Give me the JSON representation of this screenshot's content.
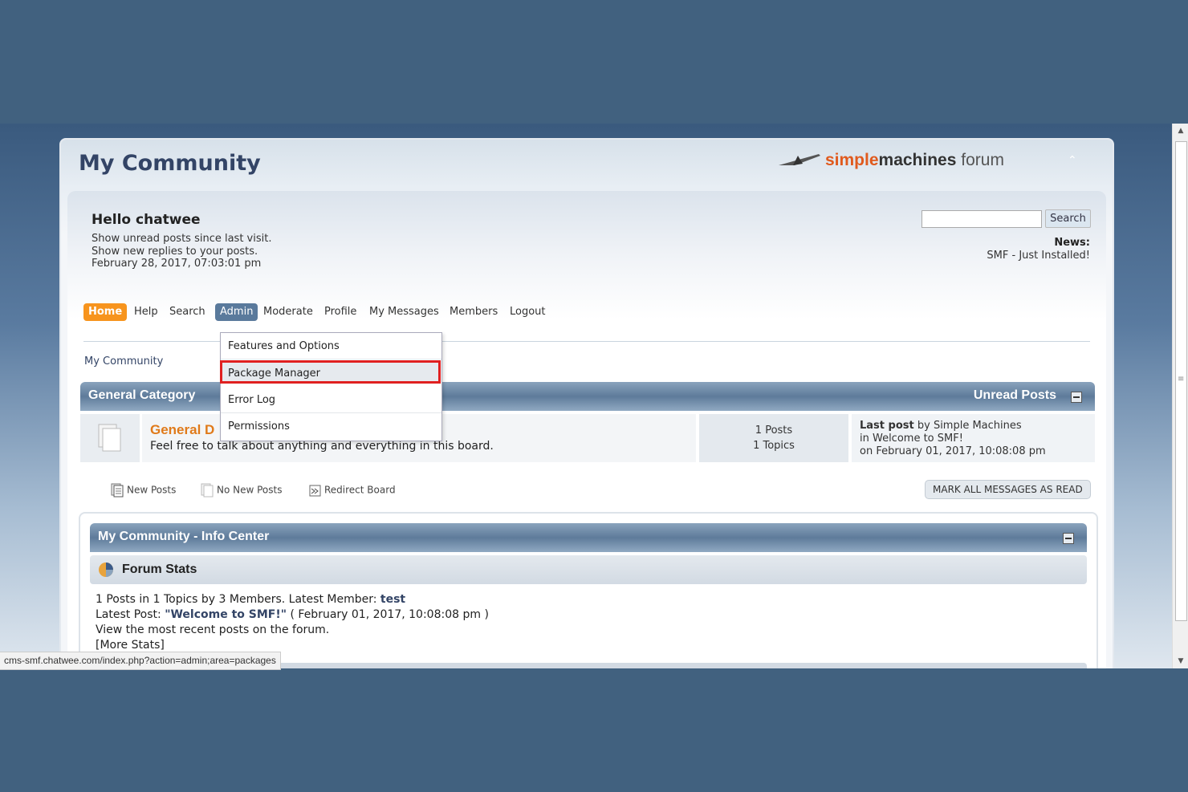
{
  "site": {
    "title": "My Community",
    "logo_a": "simple",
    "logo_b": "machines",
    "logo_c": " forum",
    "collapse_icon": "chevron-up-icon"
  },
  "user": {
    "hello": "Hello chatwee",
    "links": [
      "Show unread posts since last visit.",
      "Show new replies to your posts."
    ],
    "date": "February 28, 2017, 07:03:01 pm"
  },
  "search": {
    "value": "",
    "button": "Search"
  },
  "news": {
    "label": "News:",
    "text": "SMF - Just Installed!"
  },
  "menu": [
    "Home",
    "Help",
    "Search",
    "Admin",
    "Moderate",
    "Profile",
    "My Messages",
    "Members",
    "Logout"
  ],
  "dropdown": [
    "Features and Options",
    "Package Manager",
    "Error Log",
    "Permissions"
  ],
  "linktree": "My Community",
  "category": {
    "title": "General Category",
    "unread": "Unread Posts"
  },
  "board": {
    "name": "General D",
    "desc": "Feel free to talk about anything and everything in this board.",
    "posts": "1 Posts",
    "topics": "1 Topics",
    "last_label": "Last post",
    "last_by": " by Simple Machines",
    "last_in": "in Welcome to SMF!",
    "last_on": "on February 01, 2017, 10:08:08 pm"
  },
  "legend": [
    "New Posts",
    "No New Posts",
    "Redirect Board"
  ],
  "mark_read": "MARK ALL MESSAGES AS READ",
  "info": {
    "title": "My Community - Info Center",
    "stats_title": "Forum Stats",
    "line1_pre": "1 Posts in 1 Topics by 3 Members. Latest Member: ",
    "line1_member": "test",
    "line2_pre": "Latest Post: ",
    "line2_post": "\"Welcome to SMF!\"",
    "line2_date": " ( February 01, 2017, 10:08:08 pm )",
    "line3": "View the most recent posts on the forum.",
    "line4": "[More Stats]"
  },
  "status_url": "cms-smf.chatwee.com/index.php?action=admin;area=packages",
  "colors": {
    "accent_orange": "#f7941d",
    "header_blue": "#5e7b9a",
    "highlight_red": "#e02020",
    "page_bg": "#41617f"
  }
}
